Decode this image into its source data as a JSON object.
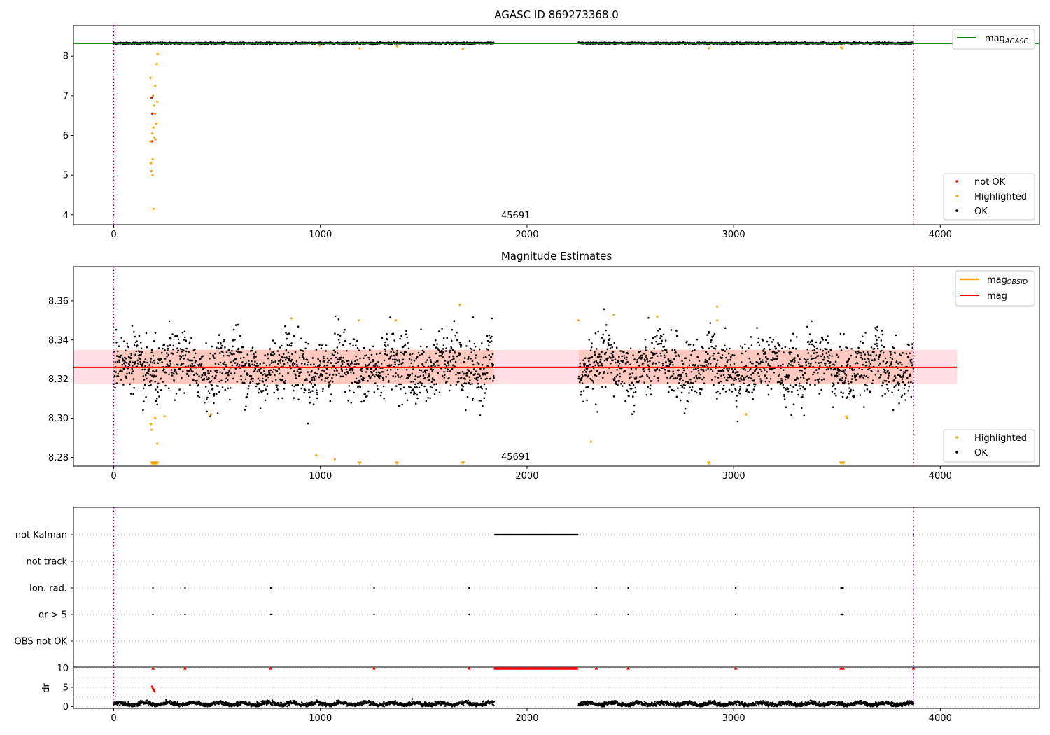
{
  "chart_data": [
    {
      "type": "scatter",
      "title": "AGASC ID 869273368.0",
      "xlim": [
        -195,
        4480
      ],
      "ylim": [
        3.75,
        8.78
      ],
      "xticks": [
        "0",
        "1000",
        "2000",
        "3000",
        "4000"
      ],
      "yticks": [
        "4",
        "5",
        "6",
        "7",
        "8"
      ],
      "obsid_label": "45691",
      "reference_line": {
        "name": "mag_AGASC",
        "label_main": "mag",
        "label_sub": "AGASC",
        "y": 8.32,
        "color": "#008000"
      },
      "obsid_boundaries": [
        0,
        3870
      ],
      "gap": [
        1840,
        2250
      ],
      "series": [
        {
          "name": "not OK",
          "color": "#ff0000",
          "points": [
            [
              183,
              6.95
            ],
            [
              186,
              6.55
            ],
            [
              185,
              5.85
            ]
          ]
        },
        {
          "name": "Highlighted",
          "color": "#ffa500",
          "points": [
            [
              178,
              7.45
            ],
            [
              190,
              7.0
            ],
            [
              195,
              6.75
            ],
            [
              200,
              6.55
            ],
            [
              192,
              6.2
            ],
            [
              205,
              6.3
            ],
            [
              186,
              6.05
            ],
            [
              196,
              5.95
            ],
            [
              202,
              5.9
            ],
            [
              180,
              5.3
            ],
            [
              188,
              5.4
            ],
            [
              182,
              5.1
            ],
            [
              188,
              5.0
            ],
            [
              193,
              4.15
            ],
            [
              210,
              6.85
            ],
            [
              208,
              7.8
            ],
            [
              212,
              8.05
            ],
            [
              200,
              7.25
            ],
            [
              178,
              5.85
            ],
            [
              997,
              8.27
            ],
            [
              1190,
              8.2
            ],
            [
              1370,
              8.25
            ],
            [
              1690,
              8.18
            ],
            [
              2880,
              8.2
            ],
            [
              3520,
              8.22
            ],
            [
              3525,
              8.2
            ]
          ]
        },
        {
          "name": "OK",
          "color": "#000000",
          "range": [
            [
              0,
              1840
            ],
            [
              2250,
              3870
            ]
          ],
          "center": 8.326,
          "spread": 0.02
        }
      ],
      "legend": {
        "position": "lower right",
        "entries": [
          "not OK",
          "Highlighted",
          "OK"
        ]
      }
    },
    {
      "type": "scatter",
      "title": "Magnitude Estimates",
      "xlim": [
        -195,
        4480
      ],
      "ylim": [
        8.2755,
        8.3775
      ],
      "xticks": [
        "0",
        "1000",
        "2000",
        "3000",
        "4000"
      ],
      "yticks": [
        "8.28",
        "8.30",
        "8.32",
        "8.34",
        "8.36"
      ],
      "obsid_label": "45691",
      "mag_line": {
        "name": "mag",
        "y": 8.326,
        "color": "#ff0000",
        "band": [
          8.3175,
          8.335
        ],
        "band_x": [
          -195,
          4080
        ]
      },
      "obsid_mag_line": {
        "name": "mag_OBSID",
        "label_main": "mag",
        "label_sub": "OBSID",
        "y": 8.326,
        "color": "#ffa500"
      },
      "obsid_boundaries": [
        0,
        3870
      ],
      "gap": [
        1840,
        2250
      ],
      "series": [
        {
          "name": "Highlighted",
          "color": "#ffa500",
          "points": [
            [
              180,
              8.297
            ],
            [
              183,
              8.294
            ],
            [
              200,
              8.3
            ],
            [
              210,
              8.287
            ],
            [
              246,
              8.301
            ],
            [
              470,
              8.302
            ],
            [
              860,
              8.351
            ],
            [
              980,
              8.281
            ],
            [
              1070,
              8.279
            ],
            [
              1185,
              8.35
            ],
            [
              1365,
              8.35
            ],
            [
              1675,
              8.358
            ],
            [
              2250,
              8.35
            ],
            [
              2310,
              8.288
            ],
            [
              2420,
              8.353
            ],
            [
              2630,
              8.352
            ],
            [
              2920,
              8.357
            ],
            [
              2920,
              8.35
            ],
            [
              3060,
              8.302
            ],
            [
              3550,
              8.3
            ],
            [
              3545,
              8.301
            ]
          ]
        },
        {
          "name": "OK",
          "color": "#000000",
          "range": [
            [
              0,
              1840
            ],
            [
              2250,
              3870
            ]
          ],
          "center": 8.326,
          "spread": 0.012
        }
      ],
      "clipped_markers": [
        185,
        190,
        195,
        200,
        205,
        210,
        1190,
        1370,
        1690,
        2880,
        3520,
        3530
      ],
      "legend": {
        "position": "lower right",
        "entries": [
          "Highlighted",
          "OK"
        ]
      },
      "legend_top": {
        "position": "upper right",
        "entries": [
          "mag_OBSID",
          "mag"
        ]
      }
    },
    {
      "type": "scatter",
      "title": "",
      "xlim": [
        -195,
        4480
      ],
      "categories": [
        "not Kalman",
        "not track",
        "Ion. rad.",
        "dr > 5",
        "OBS not OK"
      ],
      "flag_events": {
        "not Kalman": [
          [
            1845,
            2245
          ],
          [
            3870,
            3870
          ]
        ],
        "not track": [],
        "Ion. rad.": [
          [
            190,
            190
          ],
          [
            345,
            345
          ],
          [
            760,
            760
          ],
          [
            1260,
            1260
          ],
          [
            1720,
            1720
          ],
          [
            2335,
            2335
          ],
          [
            2490,
            2490
          ],
          [
            3010,
            3010
          ],
          [
            3520,
            3530
          ]
        ],
        "dr > 5": [
          [
            190,
            190
          ],
          [
            345,
            345
          ],
          [
            760,
            760
          ],
          [
            1260,
            1260
          ],
          [
            1720,
            1720
          ],
          [
            2335,
            2335
          ],
          [
            2490,
            2490
          ],
          [
            3010,
            3010
          ],
          [
            3520,
            3530
          ]
        ],
        "OBS not OK": []
      },
      "obsid_boundaries": [
        0,
        3870
      ]
    },
    {
      "type": "scatter",
      "ylabel": "dr",
      "xlim": [
        -195,
        4480
      ],
      "ylim": [
        -0.5,
        10.3
      ],
      "xticks": [
        "0",
        "1000",
        "2000",
        "3000",
        "4000"
      ],
      "yticks": [
        "0",
        "5",
        "10"
      ],
      "red_clipped_x": [
        190,
        345,
        760,
        1260,
        1720,
        2335,
        2490,
        3010,
        3520,
        3530,
        3870
      ],
      "red_clipped_range": [
        1845,
        2245
      ],
      "red_points": [
        [
          185,
          5.2
        ],
        [
          188,
          4.8
        ],
        [
          192,
          4.5
        ],
        [
          195,
          4.2
        ],
        [
          198,
          3.9
        ]
      ],
      "black_points": {
        "range": [
          [
            0,
            1840
          ],
          [
            2250,
            3870
          ]
        ],
        "center": 0.7,
        "spread": 0.5
      },
      "obsid_boundaries": [
        0,
        3870
      ]
    }
  ]
}
